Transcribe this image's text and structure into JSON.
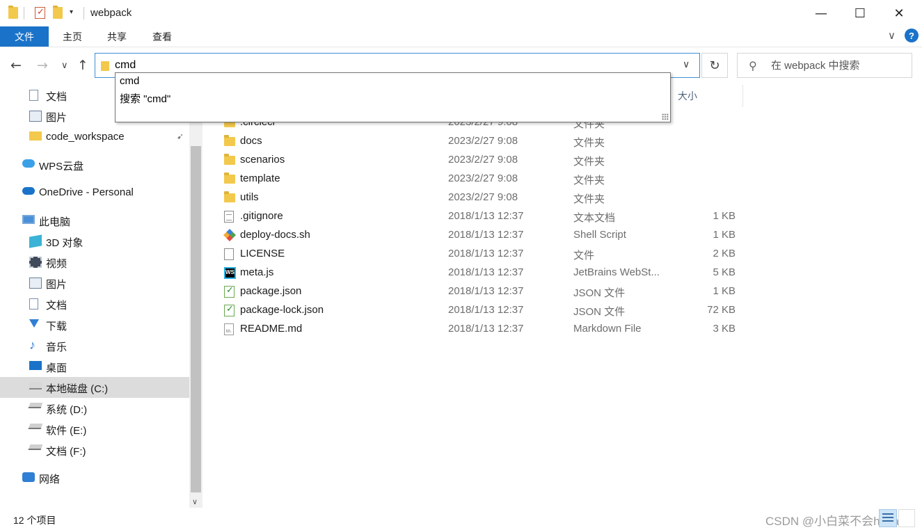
{
  "window": {
    "title": "webpack",
    "minimize_glyph": "—",
    "maximize_glyph": "☐",
    "close_glyph": "✕"
  },
  "ribbon": {
    "tabs": [
      "文件",
      "主页",
      "共享",
      "查看"
    ],
    "help_label": "?",
    "chevron_glyph": "∨"
  },
  "nav": {
    "back_glyph": "←",
    "forward_glyph": "→",
    "recent_glyph": "∨",
    "up_glyph": "↑",
    "address_value": "cmd",
    "address_caret": "∨",
    "refresh_glyph": "↻",
    "search_placeholder": "在 webpack 中搜索",
    "search_icon_glyph": "⚲"
  },
  "autocomplete": {
    "items": [
      "cmd",
      "搜索 \"cmd\""
    ]
  },
  "sidebar": {
    "items": [
      {
        "label": "文档",
        "icon": "documents-icon",
        "indent": 1
      },
      {
        "label": "图片",
        "icon": "pictures-icon",
        "indent": 1
      },
      {
        "label": "code_workspace",
        "icon": "folder-icon",
        "indent": 1,
        "pinned": true
      },
      {
        "label": "WPS云盘",
        "icon": "cloud-icon",
        "indent": 0
      },
      {
        "label": "OneDrive - Personal",
        "icon": "onedrive-icon",
        "indent": 0
      },
      {
        "label": "此电脑",
        "icon": "computer-icon",
        "indent": 0
      },
      {
        "label": "3D 对象",
        "icon": "3d-objects-icon",
        "indent": 1
      },
      {
        "label": "视频",
        "icon": "videos-icon",
        "indent": 1
      },
      {
        "label": "图片",
        "icon": "pictures-icon",
        "indent": 1
      },
      {
        "label": "文档",
        "icon": "documents-icon",
        "indent": 1
      },
      {
        "label": "下载",
        "icon": "downloads-icon",
        "indent": 1
      },
      {
        "label": "音乐",
        "icon": "music-icon",
        "indent": 1
      },
      {
        "label": "桌面",
        "icon": "desktop-icon",
        "indent": 1
      },
      {
        "label": "本地磁盘 (C:)",
        "icon": "windows-drive-icon",
        "indent": 1,
        "selected": true
      },
      {
        "label": "系统 (D:)",
        "icon": "drive-icon",
        "indent": 1
      },
      {
        "label": "软件 (E:)",
        "icon": "drive-icon",
        "indent": 1
      },
      {
        "label": "文档 (F:)",
        "icon": "drive-icon",
        "indent": 1
      },
      {
        "label": "网络",
        "icon": "network-icon",
        "indent": 0
      }
    ],
    "pin_glyph": "📌",
    "scroll_down_glyph": "∨"
  },
  "filelist": {
    "size_header": "大小",
    "rows": [
      {
        "name": ".circleci",
        "date": "2023/2/27 9:08",
        "type": "文件夹",
        "size": "",
        "icon": "folder"
      },
      {
        "name": "docs",
        "date": "2023/2/27 9:08",
        "type": "文件夹",
        "size": "",
        "icon": "folder"
      },
      {
        "name": "scenarios",
        "date": "2023/2/27 9:08",
        "type": "文件夹",
        "size": "",
        "icon": "folder"
      },
      {
        "name": "template",
        "date": "2023/2/27 9:08",
        "type": "文件夹",
        "size": "",
        "icon": "folder"
      },
      {
        "name": "utils",
        "date": "2023/2/27 9:08",
        "type": "文件夹",
        "size": "",
        "icon": "folder"
      },
      {
        "name": ".gitignore",
        "date": "2018/1/13 12:37",
        "type": "文本文档",
        "size": "1 KB",
        "icon": "text"
      },
      {
        "name": "deploy-docs.sh",
        "date": "2018/1/13 12:37",
        "type": "Shell Script",
        "size": "1 KB",
        "icon": "shell"
      },
      {
        "name": "LICENSE",
        "date": "2018/1/13 12:37",
        "type": "文件",
        "size": "2 KB",
        "icon": "blank"
      },
      {
        "name": "meta.js",
        "date": "2018/1/13 12:37",
        "type": "JetBrains WebSt...",
        "size": "5 KB",
        "icon": "ws"
      },
      {
        "name": "package.json",
        "date": "2018/1/13 12:37",
        "type": "JSON 文件",
        "size": "1 KB",
        "icon": "json"
      },
      {
        "name": "package-lock.json",
        "date": "2018/1/13 12:37",
        "type": "JSON 文件",
        "size": "72 KB",
        "icon": "json"
      },
      {
        "name": "README.md",
        "date": "2018/1/13 12:37",
        "type": "Markdown File",
        "size": "3 KB",
        "icon": "md"
      }
    ]
  },
  "status": {
    "item_count": "12 个项目",
    "watermark": "CSDN @小白菜不会hava"
  }
}
